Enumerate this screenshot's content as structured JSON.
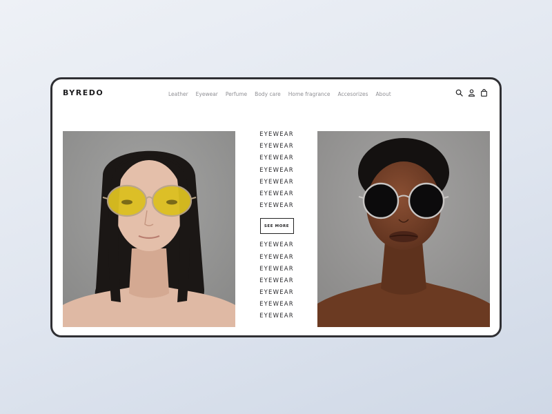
{
  "brand": {
    "logo": "BYREDO"
  },
  "nav": {
    "items": [
      {
        "label": "Leather"
      },
      {
        "label": "Eyewear"
      },
      {
        "label": "Perfume"
      },
      {
        "label": "Body care"
      },
      {
        "label": "Home fragrance"
      },
      {
        "label": "Accesorizes"
      },
      {
        "label": "About"
      }
    ]
  },
  "header_icons": [
    "search-icon",
    "user-icon",
    "bag-icon"
  ],
  "center": {
    "top_list": [
      "EYEWEAR",
      "EYEWEAR",
      "EYEWEAR",
      "EYEWEAR",
      "EYEWEAR",
      "EYEWEAR",
      "EYEWEAR"
    ],
    "see_more_label": "SEE MORE",
    "bottom_list": [
      "EYEWEAR",
      "EYEWEAR",
      "EYEWEAR",
      "EYEWEAR",
      "EYEWEAR",
      "EYEWEAR",
      "EYEWEAR"
    ]
  },
  "colors": {
    "frame_border": "#2f2f33",
    "text_dark": "#2a2a2d",
    "nav_text": "#8f8f94",
    "photo_bg": "#8f8f8e"
  }
}
